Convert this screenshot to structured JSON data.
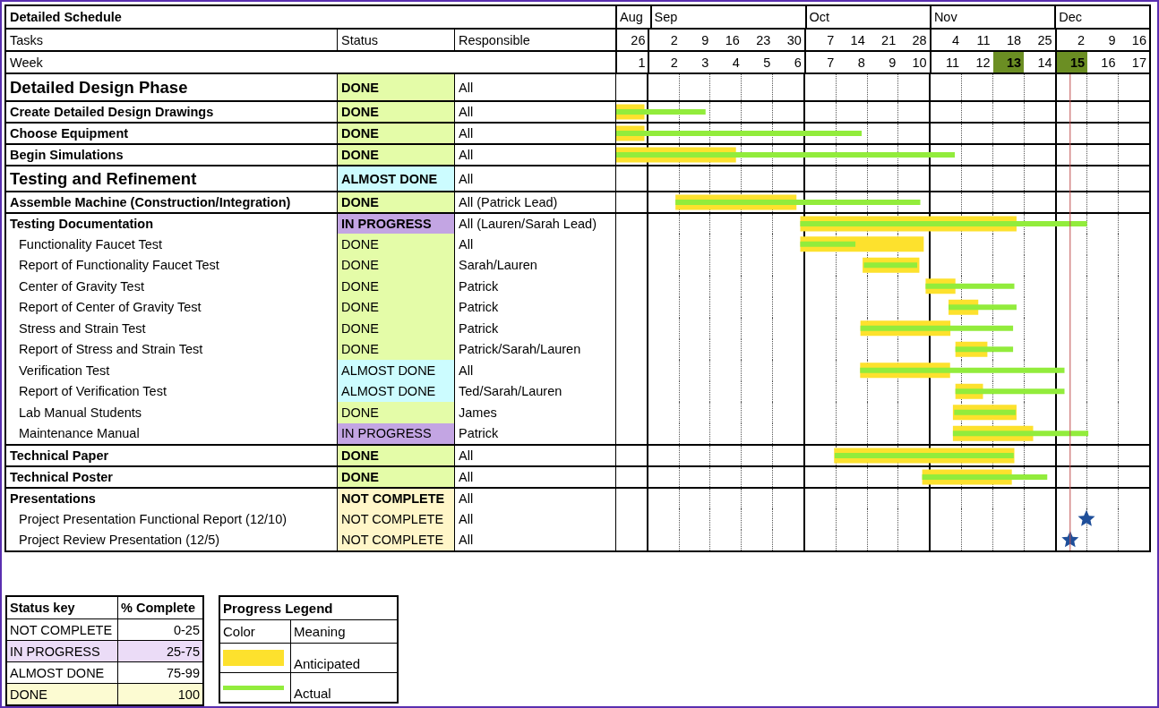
{
  "title": "Detailed Schedule",
  "headers": {
    "tasks": "Tasks",
    "status": "Status",
    "responsible": "Responsible",
    "week": "Week"
  },
  "months": [
    {
      "label": "Aug",
      "weeks": [
        {
          "date": "26",
          "number": "1",
          "highlighted": false
        }
      ]
    },
    {
      "label": "Sep",
      "weeks": [
        {
          "date": "2",
          "number": "2",
          "highlighted": false
        },
        {
          "date": "9",
          "number": "3",
          "highlighted": false
        },
        {
          "date": "16",
          "number": "4",
          "highlighted": false
        },
        {
          "date": "23",
          "number": "5",
          "highlighted": false
        },
        {
          "date": "30",
          "number": "6",
          "highlighted": false
        }
      ]
    },
    {
      "label": "Oct",
      "weeks": [
        {
          "date": "7",
          "number": "7",
          "highlighted": false
        },
        {
          "date": "14",
          "number": "8",
          "highlighted": false
        },
        {
          "date": "21",
          "number": "9",
          "highlighted": false
        },
        {
          "date": "28",
          "number": "10",
          "highlighted": false
        }
      ]
    },
    {
      "label": "Nov",
      "weeks": [
        {
          "date": "4",
          "number": "11",
          "highlighted": false
        },
        {
          "date": "11",
          "number": "12",
          "highlighted": false
        },
        {
          "date": "18",
          "number": "13",
          "highlighted": true
        },
        {
          "date": "25",
          "number": "14",
          "highlighted": false
        }
      ]
    },
    {
      "label": "Dec",
      "weeks": [
        {
          "date": "2",
          "number": "15",
          "highlighted": true
        },
        {
          "date": "9",
          "number": "16",
          "highlighted": false
        },
        {
          "date": "16",
          "number": "17",
          "highlighted": false
        }
      ]
    }
  ],
  "rows": [
    {
      "kind": "phase",
      "task": "Detailed Design Phase",
      "status": {
        "text": "DONE",
        "color": "#e4fca8"
      },
      "responsible": "All"
    },
    {
      "kind": "task",
      "task": "Create Detailed Design Drawings",
      "status": {
        "text": "DONE",
        "color": "#e4fca8"
      },
      "responsible": "All"
    },
    {
      "kind": "task",
      "task": "Choose Equipment",
      "status": {
        "text": "DONE",
        "color": "#e4fca8"
      },
      "responsible": "All"
    },
    {
      "kind": "task",
      "task": "Begin Simulations",
      "status": {
        "text": "DONE",
        "color": "#e4fca8"
      },
      "responsible": "All"
    },
    {
      "kind": "phase",
      "task": "Testing and Refinement",
      "status": {
        "text": "ALMOST DONE",
        "color": "#ccfcff"
      },
      "responsible": "All"
    },
    {
      "kind": "task",
      "task": "Assemble Machine (Construction/Integration)",
      "status": {
        "text": "DONE",
        "color": "#e4fca8"
      },
      "responsible": "All (Patrick Lead)"
    },
    {
      "kind": "task",
      "task": "Testing Documentation",
      "status": {
        "text": "IN PROGRESS",
        "color": "#c3a5e3"
      },
      "responsible": "All (Lauren/Sarah Lead)"
    },
    {
      "kind": "subtask",
      "task": "Functionality Faucet Test",
      "status": {
        "text": "DONE",
        "color": "#e4fca8"
      },
      "responsible": "All"
    },
    {
      "kind": "subtask",
      "task": "Report of Functionality Faucet Test",
      "status": {
        "text": "DONE",
        "color": "#e4fca8"
      },
      "responsible": "Sarah/Lauren"
    },
    {
      "kind": "subtask",
      "task": "Center of Gravity Test",
      "status": {
        "text": "DONE",
        "color": "#e4fca8"
      },
      "responsible": "Patrick"
    },
    {
      "kind": "subtask",
      "task": "Report of Center of Gravity Test",
      "status": {
        "text": "DONE",
        "color": "#e4fca8"
      },
      "responsible": "Patrick"
    },
    {
      "kind": "subtask",
      "task": "Stress and Strain Test",
      "status": {
        "text": "DONE",
        "color": "#e4fca8"
      },
      "responsible": "Patrick"
    },
    {
      "kind": "subtask",
      "task": "Report of Stress and Strain Test",
      "status": {
        "text": "DONE",
        "color": "#e4fca8"
      },
      "responsible": "Patrick/Sarah/Lauren"
    },
    {
      "kind": "subtask",
      "task": "Verification Test",
      "status": {
        "text": "ALMOST DONE",
        "color": "#ccfcff"
      },
      "responsible": "All"
    },
    {
      "kind": "subtask",
      "task": "Report of Verification Test",
      "status": {
        "text": "ALMOST DONE",
        "color": "#ccfcff"
      },
      "responsible": "Ted/Sarah/Lauren"
    },
    {
      "kind": "subtask",
      "task": "Lab Manual Students",
      "status": {
        "text": "DONE",
        "color": "#e4fca8"
      },
      "responsible": "James"
    },
    {
      "kind": "subtask",
      "task": "Maintenance Manual",
      "status": {
        "text": "IN PROGRESS",
        "color": "#c3a5e3"
      },
      "responsible": "Patrick"
    },
    {
      "kind": "task",
      "task": "Technical Paper",
      "status": {
        "text": "DONE",
        "color": "#e4fca8"
      },
      "responsible": "All"
    },
    {
      "kind": "task",
      "task": "Technical Poster",
      "status": {
        "text": "DONE",
        "color": "#e4fca8"
      },
      "responsible": "All"
    },
    {
      "kind": "task",
      "task": "Presentations",
      "status": {
        "text": "NOT COMPLETE",
        "color": "#fff6c8"
      },
      "responsible": "All"
    },
    {
      "kind": "subtask",
      "task": "Project Presentation Functional Report (12/10)",
      "status": {
        "text": "NOT COMPLETE",
        "color": "#fff6c8"
      },
      "responsible": "All"
    },
    {
      "kind": "subtask",
      "task": "Project Review Presentation (12/5)",
      "status": {
        "text": "NOT COMPLETE",
        "color": "#fff6c8"
      },
      "responsible": "All"
    }
  ],
  "status_key": {
    "headers": [
      "Status key",
      "% Complete"
    ],
    "items": [
      {
        "status": "NOT COMPLETE",
        "range": "0-25",
        "color": "#ffffff"
      },
      {
        "status": "IN PROGRESS",
        "range": "25-75",
        "color": "#ebdcf7"
      },
      {
        "status": "ALMOST DONE",
        "range": "75-99",
        "color": "#ffffff"
      },
      {
        "status": "DONE",
        "range": "100",
        "color": "#fcfbd2"
      }
    ]
  },
  "progress_legend": {
    "title": "Progress Legend",
    "headers": [
      "Color",
      "Meaning"
    ],
    "items": [
      {
        "kind": "anticipated",
        "meaning": "Anticipated"
      },
      {
        "kind": "actual",
        "meaning": "Actual"
      }
    ]
  }
}
